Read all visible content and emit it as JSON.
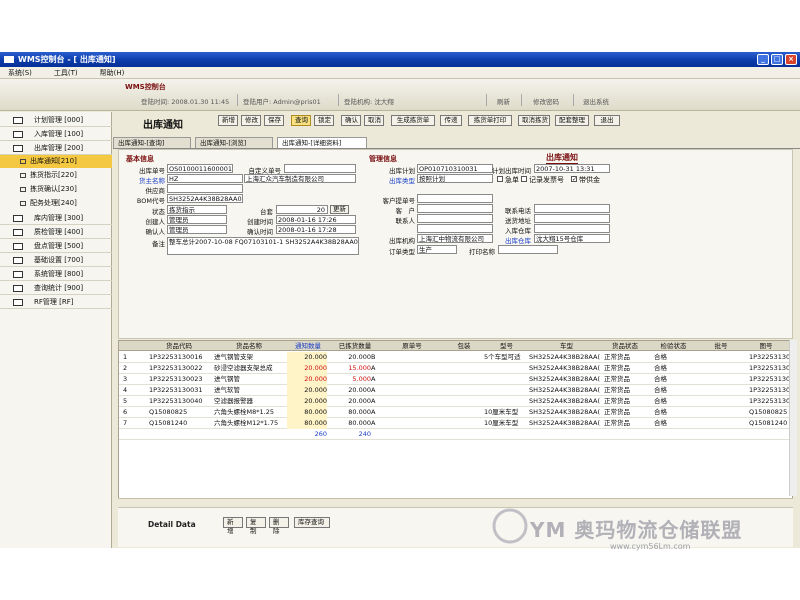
{
  "window": {
    "title": "WMS控制台 - [ 出库通知]",
    "min": "_",
    "max": "□",
    "close": "×"
  },
  "menu": [
    "系统(S)",
    "工具(T)",
    "帮助(H)"
  ],
  "info": {
    "logo": "WMS控制台",
    "login_time": "登陆时间: 2008.01.30 11:45",
    "login_user": "登陆用户: Admin@pris01",
    "login_org": "登陆机构: 沈大翔",
    "refresh": "刷新",
    "change_pwd": "修改密码",
    "exit": "退出系统"
  },
  "nav": [
    {
      "label": "计划管理 [000]"
    },
    {
      "label": "入库管理 [100]"
    },
    {
      "label": "出库管理 [200]"
    }
  ],
  "sub": [
    {
      "label": "出库通知[210]"
    },
    {
      "label": "拣货指示[220]"
    },
    {
      "label": "拣货确认[230]"
    },
    {
      "label": "配务处理[240]"
    }
  ],
  "nav2": [
    {
      "label": "库内管理 [300]"
    },
    {
      "label": "质检管理 [400]"
    },
    {
      "label": "盘点管理 [500]"
    },
    {
      "label": "基础设置 [700]"
    },
    {
      "label": "系统管理 [800]"
    },
    {
      "label": "查询统计 [900]"
    },
    {
      "label": "RF管理 [RF]"
    }
  ],
  "page": {
    "title": "出库通知"
  },
  "toolbar": [
    "新增",
    "修改",
    "保存",
    "查询",
    "锁定",
    "确认",
    "取消",
    "生成拣货单",
    "传递",
    "拣货单打印",
    "取消拣货",
    "配套整理",
    "退出"
  ],
  "tabs": [
    "出库通知-[查询]",
    "出库通知-[浏览]",
    "出库通知-[详细资料]"
  ],
  "form": {
    "basic_title": "基本信息",
    "mgmt_title": "管理信息",
    "print_title": "出库通知",
    "notice_no_label": "出库单号",
    "notice_no": "OS0100011600001",
    "custom_no_label": "自定义单号",
    "custom_no": "",
    "owner_label": "货主名称",
    "owner_code": "HZ",
    "owner_name": "上海汇众汽车制造有限公司",
    "supplier_label": "供应商",
    "supplier": "",
    "bom_label": "BOM代号",
    "bom": "SH3252A4K38B28AA02",
    "status_label": "状态",
    "status": "拣货指示",
    "stage_label": "台套",
    "stage": "20",
    "stage_btn": "更新",
    "creator_label": "创建人",
    "creator": "管理员",
    "create_time_label": "创建时间",
    "create_time": "2008-01-16 17:26",
    "confirmer_label": "确认人",
    "confirmer": "管理员",
    "confirm_time_label": "确认时间",
    "confirm_time": "2008-01-16 17:28",
    "remark_label": "备注",
    "remark": "整车总计2007-10-08 FQ07103101-1 SH3252A4K38B28AA02",
    "plan_label": "出库计划",
    "plan": "OP010710310031",
    "plan_time_label": "计划出库时间",
    "plan_time": "2007-10-31 13:31",
    "type_label": "出库类型",
    "type": "按照计划",
    "urgent_label": "急单",
    "record_label": "记录发票号",
    "with_label": "带供金",
    "cust_no_label": "客户提单号",
    "cust_no": "",
    "customer_label": "客　户",
    "customer": "",
    "contact_label": "联系人",
    "contact": "",
    "phone_label": "联系电话",
    "phone": "",
    "address_label": "送货地址",
    "address": "",
    "in_wh_label": "入库仓库",
    "in_wh": "",
    "org_label": "出库机构",
    "org": "上海汇中物流有限公司",
    "out_wh_label": "出库仓库",
    "out_wh": "沈大翔15号仓库",
    "order_type_label": "订单类型",
    "order_type": "生产",
    "print_name_label": "打印名称",
    "print_name": ""
  },
  "grid": {
    "headers": [
      "货品代码",
      "货品名称",
      "通知数量",
      "已拣货数量",
      "原单号",
      "包装",
      "型号",
      "车型",
      "货品状态",
      "检验状态",
      "批号",
      "图号"
    ],
    "rows": [
      {
        "n": "1",
        "code": "1P32253130016",
        "name": "进气钢管支架",
        "qty": "20.000",
        "picked": "20.000",
        "u": "B",
        "pkg": "",
        "model": "5个车型可适",
        "car": "SH3252A4K38B28AA(",
        "gstatus": "正常货品",
        "check": "合格",
        "batch": "",
        "drawing": "1P32253130016"
      },
      {
        "n": "2",
        "code": "1P32253130022",
        "name": "砂浸空滤器支架总成",
        "qty": "20.000",
        "picked": "15.000",
        "u": "A",
        "pkg": "",
        "model": "",
        "car": "SH3252A4K38B28AA(",
        "gstatus": "正常货品",
        "check": "合格",
        "batch": "",
        "drawing": "1P32253130022"
      },
      {
        "n": "3",
        "code": "1P32253130023",
        "name": "进气钢管",
        "qty": "20.000",
        "picked": "5.000",
        "u": "A",
        "pkg": "",
        "model": "",
        "car": "SH3252A4K38B28AA(",
        "gstatus": "正常货品",
        "check": "合格",
        "batch": "",
        "drawing": "1P32253130023"
      },
      {
        "n": "4",
        "code": "1P32253130031",
        "name": "进气软管",
        "qty": "20.000",
        "picked": "20.000",
        "u": "A",
        "pkg": "",
        "model": "",
        "car": "SH3252A4K38B28AA(",
        "gstatus": "正常货品",
        "check": "合格",
        "batch": "",
        "drawing": "1P32253130031"
      },
      {
        "n": "5",
        "code": "1P32253130040",
        "name": "空滤器报警器",
        "qty": "20.000",
        "picked": "20.000",
        "u": "A",
        "pkg": "",
        "model": "",
        "car": "SH3252A4K38B28AA(",
        "gstatus": "正常货品",
        "check": "合格",
        "batch": "",
        "drawing": "1P32253130040"
      },
      {
        "n": "6",
        "code": "Q15080825",
        "name": "六角头螺栓M8*1.25",
        "qty": "80.000",
        "picked": "80.000",
        "u": "A",
        "pkg": "",
        "model": "10厘米车型",
        "car": "SH3252A4K38B28AA(",
        "gstatus": "正常货品",
        "check": "合格",
        "batch": "",
        "drawing": "Q15080825"
      },
      {
        "n": "7",
        "code": "Q15081240",
        "name": "六角头螺栓M12*1.75",
        "qty": "80.000",
        "picked": "80.000",
        "u": "A",
        "pkg": "",
        "model": "10厘米车型",
        "car": "SH3252A4K38B28AA(",
        "gstatus": "正常货品",
        "check": "合格",
        "batch": "",
        "drawing": "Q15081240"
      }
    ],
    "total_qty": "260",
    "total_picked": "240"
  },
  "bottom": {
    "label": "Detail Data",
    "buttons": [
      "新增",
      "复制",
      "删除",
      "库存查询"
    ]
  },
  "watermark": {
    "text": "YM 奥玛物流仓储联盟",
    "url": "www.cym56Lm.com"
  }
}
